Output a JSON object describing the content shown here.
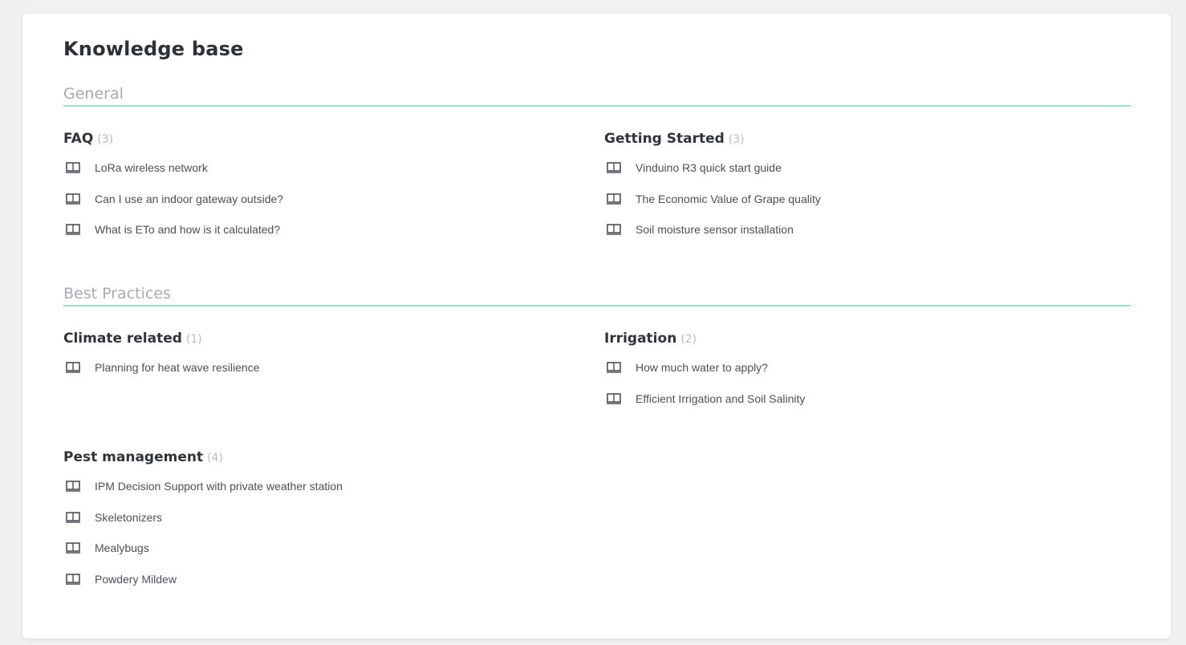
{
  "page": {
    "title": "Knowledge base"
  },
  "sections": [
    {
      "title": "General",
      "categories": [
        {
          "name": "FAQ",
          "count": "(3)",
          "articles": [
            "LoRa wireless network",
            "Can I use an indoor gateway outside?",
            "What is ETo and how is it calculated?"
          ]
        },
        {
          "name": "Getting Started",
          "count": "(3)",
          "articles": [
            "Vinduino R3 quick start guide",
            "The Economic Value of Grape quality",
            "Soil moisture sensor installation"
          ]
        }
      ]
    },
    {
      "title": "Best Practices",
      "categories": [
        {
          "name": "Climate related",
          "count": "(1)",
          "articles": [
            "Planning for heat wave resilience"
          ]
        },
        {
          "name": "Irrigation",
          "count": "(2)",
          "articles": [
            "How much water to apply?",
            "Efficient Irrigation and Soil Salinity"
          ]
        },
        {
          "name": "Pest management",
          "count": "(4)",
          "articles": [
            "IPM Decision Support with private weather station",
            "Skeletonizers",
            "Mealybugs",
            "Powdery Mildew"
          ]
        }
      ]
    }
  ],
  "icons": {
    "article": "book-icon"
  },
  "colors": {
    "accent_divider": "#a3ddc9",
    "title_text": "#2c3138",
    "muted_text": "#a6abb1"
  }
}
